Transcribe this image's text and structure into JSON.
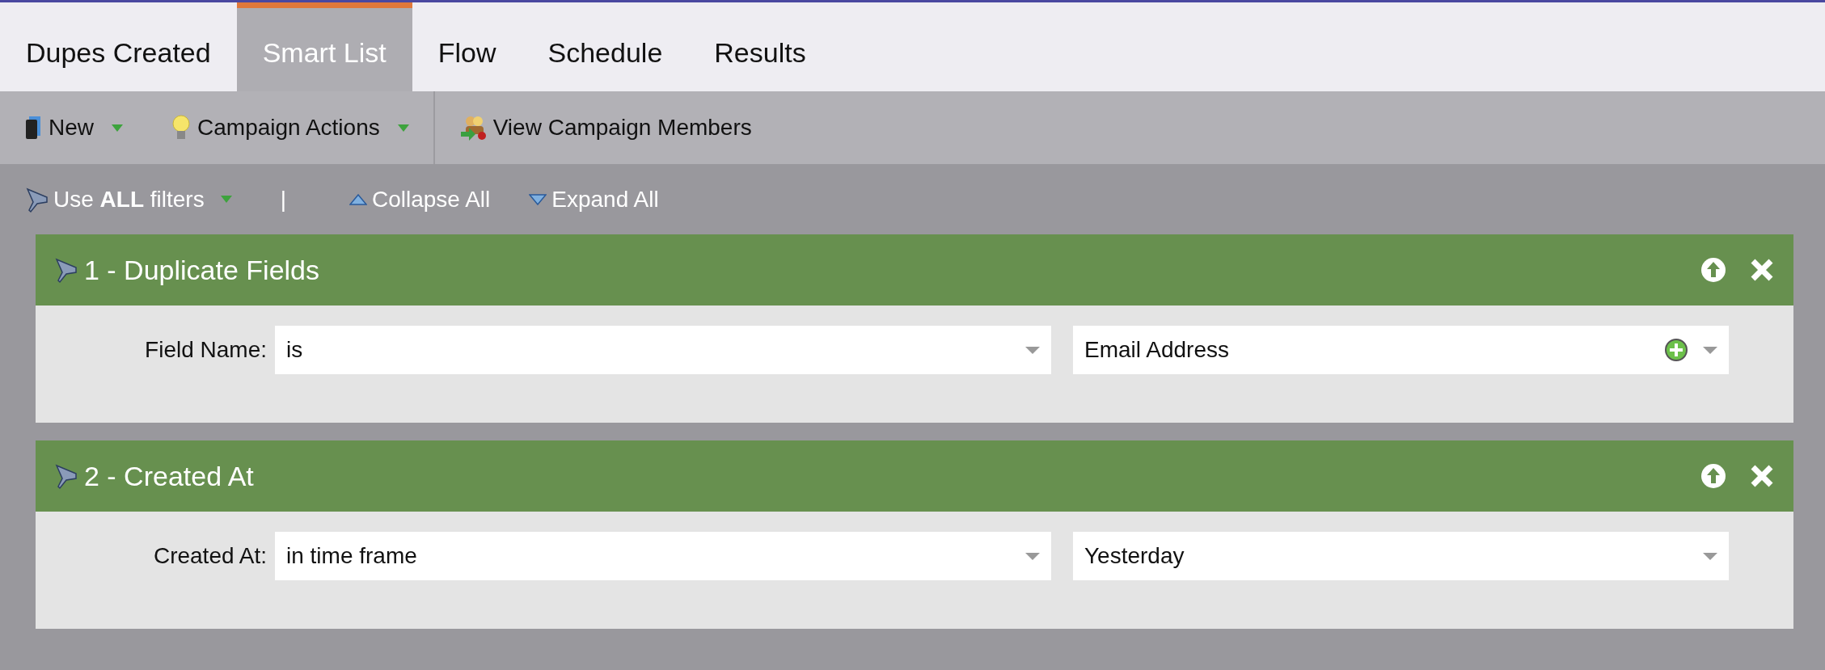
{
  "tabs": [
    {
      "label": "Dupes Created",
      "selected": false
    },
    {
      "label": "Smart List",
      "selected": true
    },
    {
      "label": "Flow",
      "selected": false
    },
    {
      "label": "Schedule",
      "selected": false
    },
    {
      "label": "Results",
      "selected": false
    }
  ],
  "toolbar": [
    {
      "kind": "book",
      "label": "New",
      "dropdown": true
    },
    {
      "kind": "bulb",
      "label": "Campaign Actions",
      "dropdown": true
    },
    {
      "kind": "people",
      "label": "View Campaign Members",
      "dropdown": false
    }
  ],
  "filter_bar": {
    "logic": "Use **ALL** filters",
    "separator": "|",
    "collapse": "Collapse All",
    "expand": "Expand All"
  },
  "filters": [
    {
      "title": "1 - Duplicate Fields",
      "rows": [
        {
          "label": "Field Name:",
          "operator": "is",
          "value": "Email Address",
          "add_button": true
        }
      ]
    },
    {
      "title": "2 - Created At",
      "rows": [
        {
          "label": "Created At:",
          "operator": "in time frame",
          "value": "Yesterday",
          "add_button": false
        }
      ]
    }
  ]
}
